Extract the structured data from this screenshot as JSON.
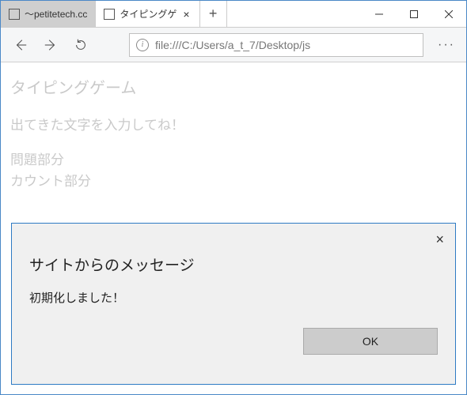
{
  "tabs": [
    {
      "label": "～petitetech.cc"
    },
    {
      "label": "タイピングゲ"
    }
  ],
  "toolbar": {
    "url": "file:///C:/Users/a_t_7/Desktop/js"
  },
  "page": {
    "title": "タイピングゲーム",
    "instruction": "出てきた文字を入力してね！",
    "problem": "問題部分",
    "count": "カウント部分"
  },
  "dialog": {
    "title": "サイトからのメッセージ",
    "message": "初期化しました！",
    "ok": "OK"
  }
}
